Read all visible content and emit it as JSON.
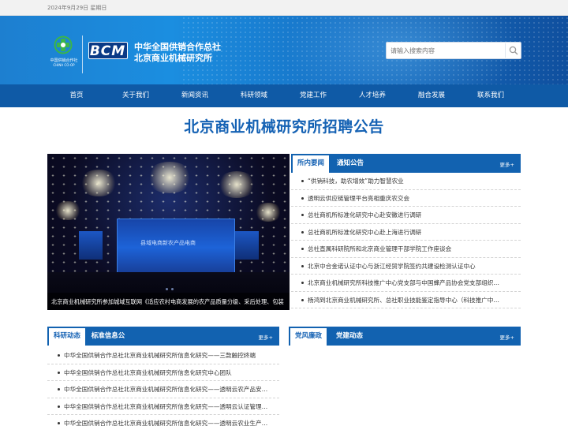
{
  "topbar": {
    "date": "2024年9月29日 星期日"
  },
  "header": {
    "coop_logo_name": "中国供销合作社",
    "coop_logo_en": "CHINA CO-OP",
    "bcm": "BCM",
    "org_line1": "中华全国供销合作总社",
    "org_line2": "北京商业机械研究所",
    "search_placeholder": "请输入搜索内容",
    "search_icon": "search-icon",
    "bg_color": "#1b8ee0"
  },
  "nav": [
    "首页",
    "关于我们",
    "新闻资讯",
    "科研领域",
    "党建工作",
    "人才培养",
    "融合发展",
    "联系我们"
  ],
  "page_title": "北京商业机械研究所招聘公告",
  "slider": {
    "caption": "北京商业机械研究所参加城域互联网《适应农村电商发展的农产品质量分级、采后处理、包装",
    "stage_text": "县域电商新农产品电商"
  },
  "news_panel": {
    "tabs": [
      "所内要闻",
      "通知公告"
    ],
    "more": "更多+",
    "items": [
      "“供销科技，助农增效”助力智慧农业",
      "透明云供应链管理平台亮相重庆农交会",
      "总社商机所标准化研究中心赴安徽进行调研",
      "总社商机所标准化研究中心赴上海进行调研",
      "总社直属科研院所和北京商业管理干部学院工作座谈会",
      "北京中合金诺认证中心与浙江经贸学院签约共建设检测认证中心",
      "北京商业机械研究所科技推广中心党支部与中国蜂产品协会党支部组织…",
      "杨鸿到北京商业机械研究所、总社职业技能鉴定指导中心（科技推广中…"
    ]
  },
  "research_panel": {
    "tabs": [
      "科研动态",
      "标准信息公"
    ],
    "more": "更多+",
    "items": [
      "中华全国供销合作总社北京商业机械研究所信息化研究——三款触控终端",
      "中华全国供销合作总社北京商业机械研究所信息化研究中心团队",
      "中华全国供销合作总社北京商业机械研究所信息化研究——透明云农产品安…",
      "中华全国供销合作总社北京商业机械研究所信息化研究——透明云认证管理…",
      "中华全国供销合作总社北京商业机械研究所信息化研究——透明云农业生产…"
    ]
  },
  "party_panel": {
    "tabs": [
      "党风廉政",
      "党建动态"
    ],
    "more": "更多+"
  },
  "colors": {
    "primary": "#1262b0",
    "title": "#1562b4"
  }
}
